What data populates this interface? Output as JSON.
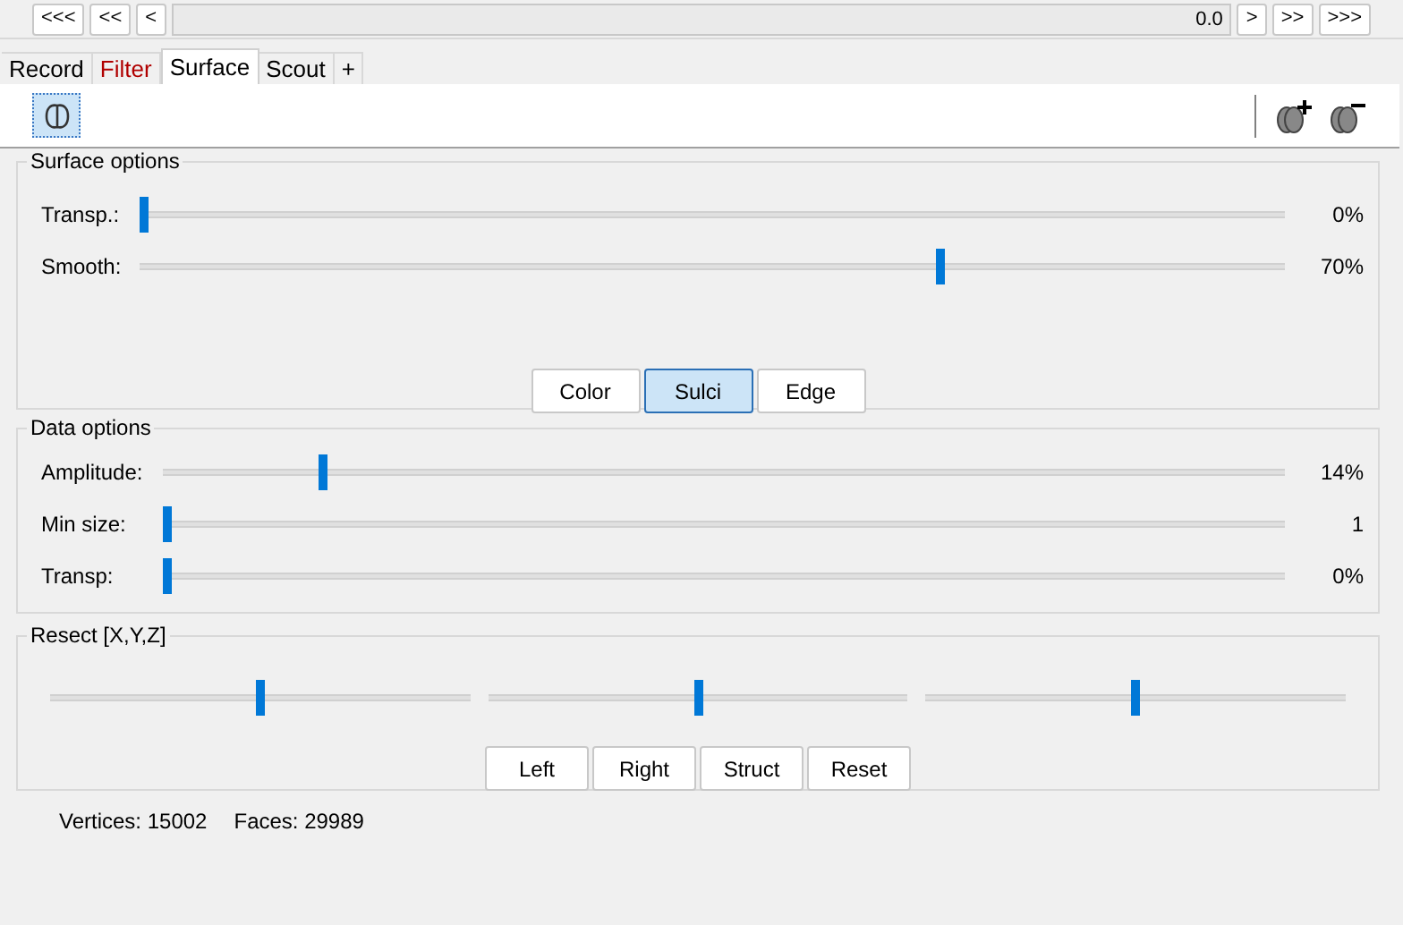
{
  "nav": {
    "buttons_left": [
      "<<<",
      "<<",
      "<"
    ],
    "time_value": "0.0",
    "buttons_right": [
      ">",
      ">>",
      ">>>"
    ]
  },
  "tabs": [
    {
      "label": "Record",
      "selected": false,
      "highlighted": false
    },
    {
      "label": "Filter",
      "selected": false,
      "highlighted": true
    },
    {
      "label": "Surface",
      "selected": true,
      "highlighted": false
    },
    {
      "label": "Scout",
      "selected": false,
      "highlighted": false
    },
    {
      "label": "+",
      "selected": false,
      "highlighted": false
    }
  ],
  "toolbar": {
    "surface_toggle": {
      "selected": true
    }
  },
  "surface_options": {
    "title": "Surface options",
    "sliders": [
      {
        "label": "Transp.:",
        "level": 0,
        "reading": "0%"
      },
      {
        "label": "Smooth:",
        "level": 0.7,
        "reading": "70%"
      }
    ],
    "buttons": [
      {
        "label": "Color",
        "selected": false
      },
      {
        "label": "Sulci",
        "selected": true
      },
      {
        "label": "Edge",
        "selected": false
      }
    ]
  },
  "data_options": {
    "title": "Data options",
    "sliders": [
      {
        "label": "Amplitude:",
        "level": 0.14,
        "reading": "14%"
      },
      {
        "label": "Min size:",
        "level": 0,
        "reading": "1"
      },
      {
        "label": "Transp:",
        "level": 0,
        "reading": "0%"
      }
    ]
  },
  "resect": {
    "title": "Resect [X,Y,Z]",
    "sliders": [
      {
        "level": 0.5
      },
      {
        "level": 0.5
      },
      {
        "level": 0.5
      }
    ],
    "buttons": [
      "Left",
      "Right",
      "Struct",
      "Reset"
    ]
  },
  "status": {
    "vertices": "Vertices: 15002",
    "faces": "Faces: 29989"
  }
}
